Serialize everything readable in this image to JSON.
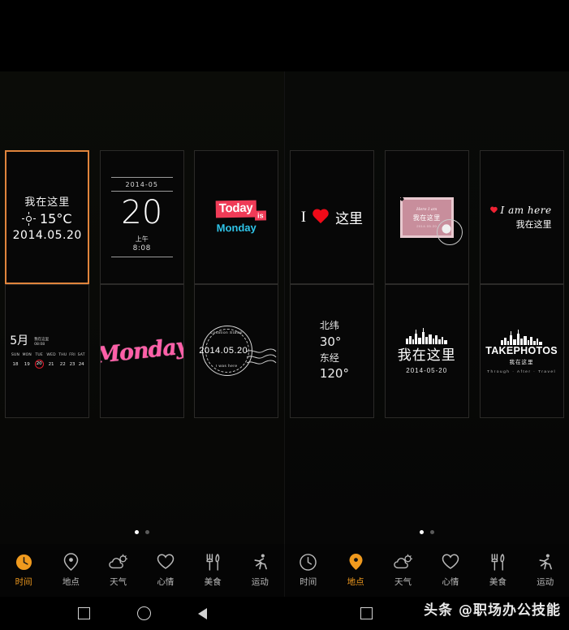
{
  "app": {
    "watermark": "头条 @职场办公技能",
    "accent_color": "#f09a1e",
    "selection_border_color": "#e0843c",
    "background_color": "#000000"
  },
  "panes": [
    {
      "id": "left-pane",
      "active_category": "时间",
      "page_dots": {
        "count": 2,
        "active_index": 0
      },
      "templates": [
        {
          "name": "weather-location-template",
          "selected": true,
          "line1": "我在这里",
          "icon": "sun-icon",
          "temperature": "15°C",
          "date": "2014.05.20"
        },
        {
          "name": "big-date-template",
          "selected": false,
          "year_month": "2014-05",
          "day": "20",
          "meridiem": "上午",
          "time": "8:08"
        },
        {
          "name": "today-is-monday-template",
          "selected": false,
          "word1": "Today",
          "word2": "is",
          "word3": "Monday",
          "color1": "#ef3b57",
          "color3": "#2fc4e8"
        },
        {
          "name": "calendar-template",
          "selected": false,
          "month": "5月",
          "note1": "我在这里",
          "note2": "08:08",
          "weekdays": [
            "SUN",
            "MON",
            "TUE",
            "WED",
            "THU",
            "FRI",
            "SAT"
          ],
          "days": [
            "18",
            "19",
            "20",
            "21",
            "22",
            "23",
            "24"
          ],
          "today_index": 2
        },
        {
          "name": "monday-script-template",
          "selected": false,
          "text": "Monday",
          "color": "#ff5fa8"
        },
        {
          "name": "postmark-template",
          "selected": false,
          "date": "2014.05.20",
          "arc_top": "Location Stamp",
          "arc_bottom": "I was here"
        }
      ]
    },
    {
      "id": "right-pane",
      "active_category": "地点",
      "page_dots": {
        "count": 2,
        "active_index": 0
      },
      "templates": [
        {
          "name": "i-love-here-template",
          "selected": false,
          "word1": "I",
          "icon": "heart-icon",
          "word2": "这里"
        },
        {
          "name": "postage-stamp-template",
          "selected": false,
          "script": "Here I am",
          "title": "我在这里",
          "sub": "2014.05.20"
        },
        {
          "name": "i-am-here-script-template",
          "selected": false,
          "icon": "heart-icon",
          "line1": "I am here",
          "line2": "我在这里"
        },
        {
          "name": "coordinates-template",
          "selected": false,
          "lat_label": "北纬",
          "lat_value": "30°",
          "lng_label": "东经",
          "lng_value": "120°"
        },
        {
          "name": "skyline-here-template",
          "selected": false,
          "icon": "skyline-icon",
          "title": "我在这里",
          "date": "2014-05-20"
        },
        {
          "name": "takephotos-template",
          "selected": false,
          "icon": "skyline-icon",
          "title": "TAKEPHOTOS",
          "subtitle": "我在这里",
          "arc": "Through · After · Travel"
        }
      ]
    }
  ],
  "toolbar": {
    "items": [
      {
        "label": "时间",
        "icon": "clock-icon"
      },
      {
        "label": "地点",
        "icon": "location-pin-icon"
      },
      {
        "label": "天气",
        "icon": "cloud-sun-icon"
      },
      {
        "label": "心情",
        "icon": "heart-outline-icon"
      },
      {
        "label": "美食",
        "icon": "fork-knife-icon"
      },
      {
        "label": "运动",
        "icon": "runner-icon"
      }
    ],
    "left_active_index": 0,
    "right_active_index": 1
  },
  "navbar": {
    "left_buttons": [
      "recents-square-icon",
      "home-circle-icon",
      "back-triangle-icon"
    ],
    "right_buttons": [
      "recents-square-icon"
    ]
  }
}
